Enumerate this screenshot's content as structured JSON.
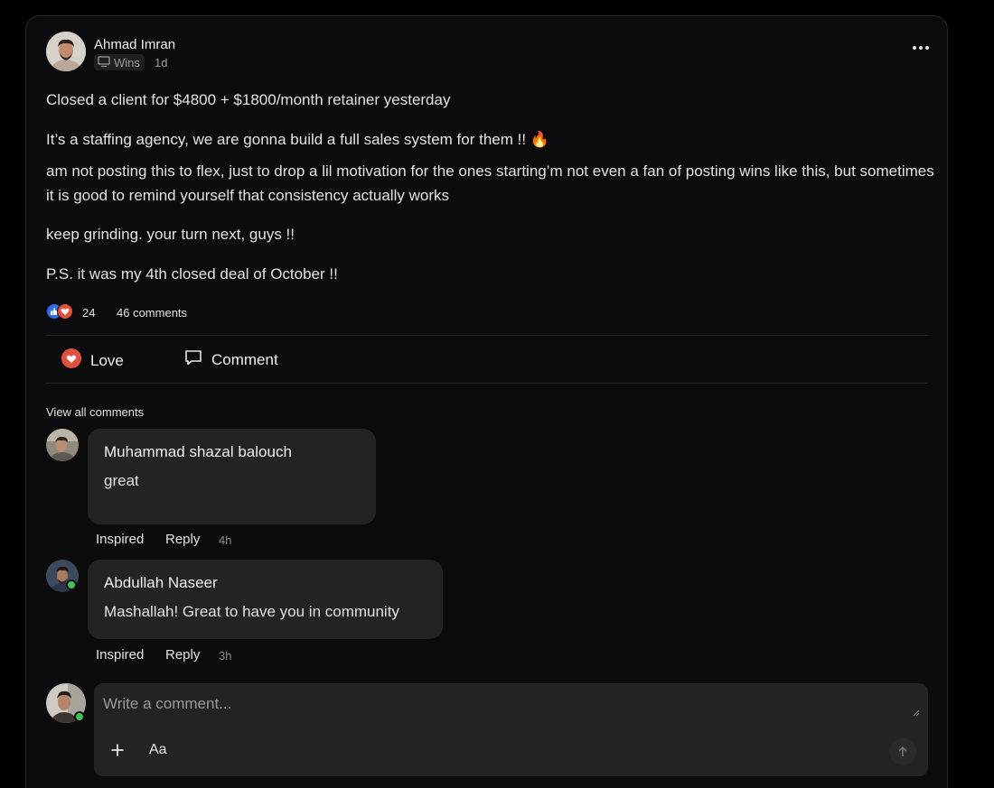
{
  "post": {
    "author": "Ahmad Imran",
    "category": "Wins",
    "time": "1d",
    "title_line": "Closed a client for $4800 + $1800/month retainer yesterday",
    "line2": "It’s a staffing agency, we are gonna build a full sales system for them !! 🔥",
    "line3": "am not posting this to flex, just to drop a lil motivation for the ones starting’m not even a fan of posting wins like this, but sometimes it is good to remind yourself that consistency actually works",
    "line4": "keep grinding. your turn next, guys !!",
    "line5": "P.S. it was my 4th closed deal of October !!"
  },
  "stats": {
    "reactions": "24",
    "comments": "46 comments"
  },
  "actions": {
    "love": "Love",
    "comment": "Comment"
  },
  "view_all": "View all comments",
  "comments": [
    {
      "name": "Muhammad shazal balouch",
      "text": "great",
      "inspired": "Inspired",
      "reply": "Reply",
      "time": "4h"
    },
    {
      "name": "Abdullah Naseer",
      "text": "Mashallah! Great to have you in community",
      "inspired": "Inspired",
      "reply": "Reply",
      "time": "3h"
    }
  ],
  "composer": {
    "placeholder": "Write a comment...",
    "font_label": "Aa"
  },
  "colors": {
    "love": "#e0513d",
    "like": "#2f6fe4",
    "online": "#3ec460"
  },
  "icons": [
    "more-icon",
    "monitor-icon",
    "heart-icon",
    "comment-icon",
    "plus-icon",
    "send-arrow-icon"
  ]
}
